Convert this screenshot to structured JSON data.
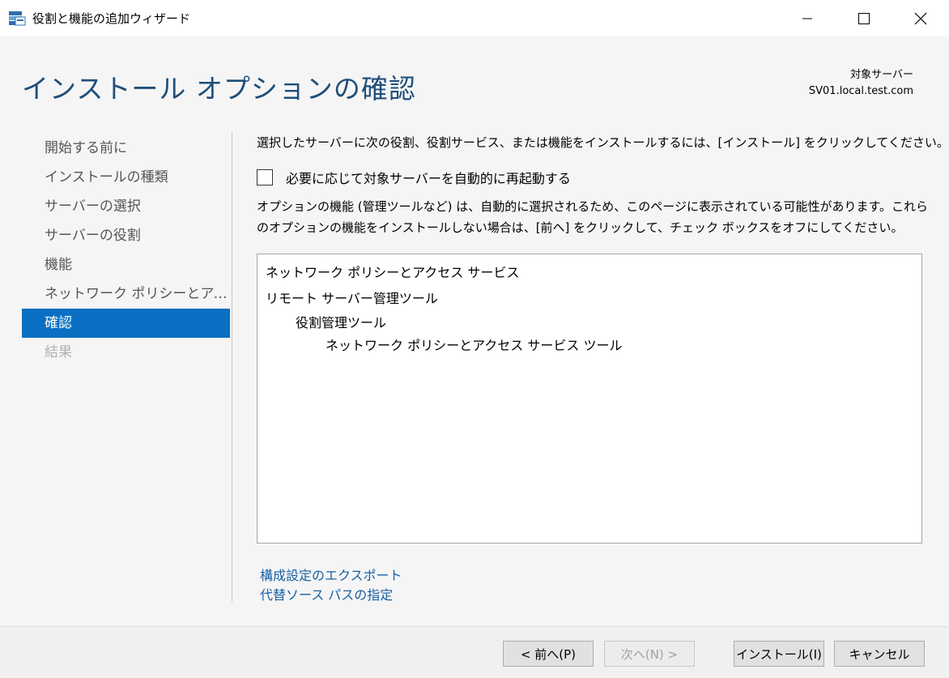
{
  "window": {
    "title": "役割と機能の追加ウィザード"
  },
  "header": {
    "page_title": "インストール オプションの確認",
    "target_label": "対象サーバー",
    "target_value": "SV01.local.test.com"
  },
  "nav": {
    "items": [
      {
        "label": "開始する前に"
      },
      {
        "label": "インストールの種類"
      },
      {
        "label": "サーバーの選択"
      },
      {
        "label": "サーバーの役割"
      },
      {
        "label": "機能"
      },
      {
        "label": "ネットワーク ポリシーとアクセ..."
      },
      {
        "label": "確認"
      },
      {
        "label": "結果"
      }
    ]
  },
  "main": {
    "intro": "選択したサーバーに次の役割、役割サービス、または機能をインストールするには、[インストール] をクリックしてください。",
    "restart_label": "必要に応じて対象サーバーを自動的に再起動する",
    "note": "オプションの機能 (管理ツールなど) は、自動的に選択されるため、このページに表示されている可能性があります。これらのオプションの機能をインストールしない場合は、[前へ] をクリックして、チェック ボックスをオフにしてください。",
    "features": [
      "ネットワーク ポリシーとアクセス サービス",
      "リモート サーバー管理ツール",
      "役割管理ツール",
      "ネットワーク ポリシーとアクセス サービス ツール"
    ],
    "export_link": "構成設定のエクスポート",
    "source_link": "代替ソース パスの指定"
  },
  "buttons": {
    "prev": "< 前へ(P)",
    "next": "次へ(N) >",
    "install": "インストール(I)",
    "cancel": "キャンセル"
  },
  "colors": {
    "accent": "#0a6fc2",
    "title": "#1f4e79",
    "link": "#1a5fa3"
  }
}
